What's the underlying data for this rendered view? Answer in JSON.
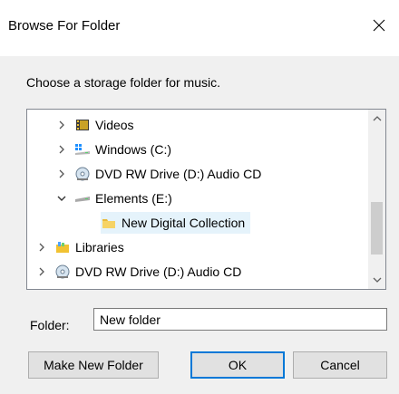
{
  "dialog": {
    "title": "Browse For Folder",
    "instruction": "Choose a storage folder for music."
  },
  "tree": {
    "items": [
      {
        "label": "Videos",
        "icon": "videos-icon",
        "expander": "collapsed"
      },
      {
        "label": "Windows (C:)",
        "icon": "windows-drive-icon",
        "expander": "collapsed"
      },
      {
        "label": "DVD RW Drive (D:) Audio CD",
        "icon": "dvd-drive-icon",
        "expander": "collapsed"
      },
      {
        "label": "Elements (E:)",
        "icon": "external-drive-icon",
        "expander": "expanded"
      },
      {
        "label": "New Digital Collection",
        "icon": "folder-icon",
        "expander": "none",
        "selected": true
      },
      {
        "label": "Libraries",
        "icon": "libraries-icon",
        "expander": "collapsed"
      },
      {
        "label": "DVD RW Drive (D:) Audio CD",
        "icon": "dvd-drive-icon",
        "expander": "collapsed"
      }
    ]
  },
  "folder_field": {
    "label": "Folder:",
    "value": "New folder"
  },
  "buttons": {
    "make_new_folder": "Make New Folder",
    "ok": "OK",
    "cancel": "Cancel"
  },
  "colors": {
    "selection": "#e5f3fb",
    "accent": "#0078d7",
    "dialog_bg": "#f0f0f0"
  }
}
